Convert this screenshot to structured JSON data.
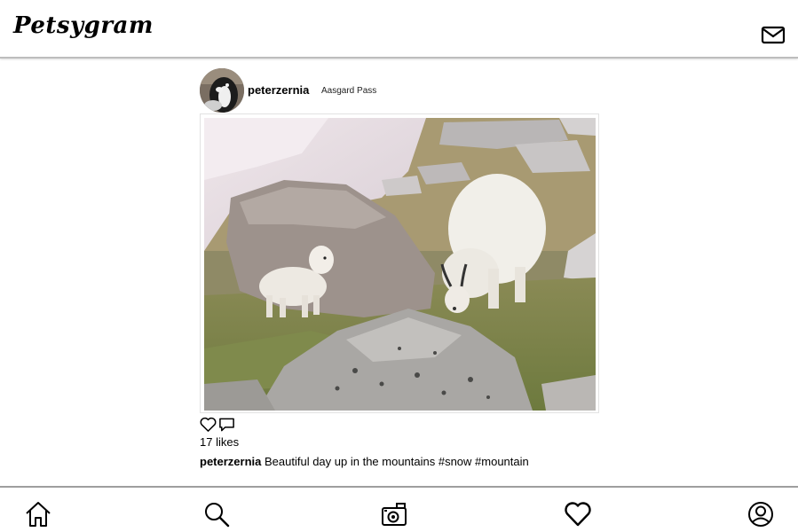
{
  "app": {
    "title": "Petsygram"
  },
  "header": {
    "logo_text": "Petsygram",
    "mail_icon": "mail-icon"
  },
  "post": {
    "username": "peterzernia",
    "location": "Aasgard Pass",
    "photo_subject": "mountain goats",
    "likes_text": "17 likes",
    "caption_user": "peterzernia",
    "caption_text": "Beautiful day up in the mountains #snow #mountain",
    "actions": [
      "heart-icon",
      "comment-icon"
    ]
  },
  "bottom_nav": {
    "items": [
      "home-icon",
      "search-icon",
      "camera-icon",
      "heart-icon",
      "profile-icon"
    ]
  }
}
